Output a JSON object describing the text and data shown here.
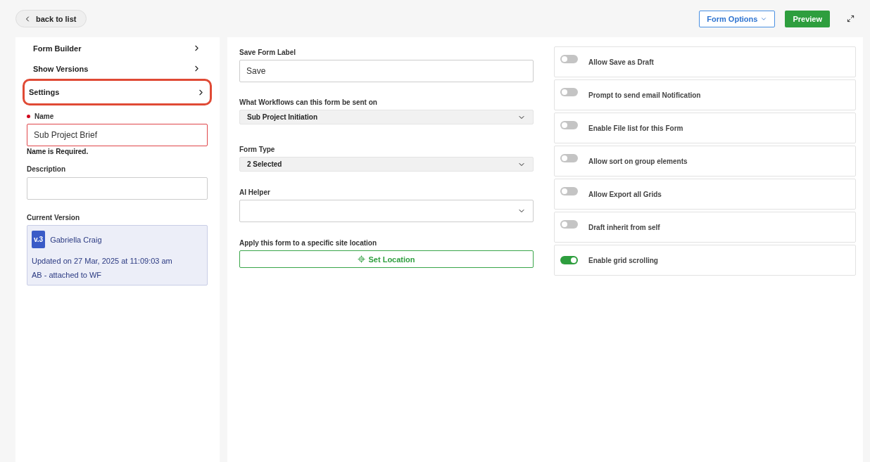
{
  "header": {
    "back_button": "back to list",
    "form_options": "Form Options",
    "preview": "Preview"
  },
  "nav": [
    {
      "label": "Form Builder",
      "highlighted": false
    },
    {
      "label": "Show Versions",
      "highlighted": false
    },
    {
      "label": "Settings",
      "highlighted": true
    }
  ],
  "name_field": {
    "label": "Name",
    "required": true,
    "value": "Sub Project Brief",
    "error": "Name is Required."
  },
  "description_field": {
    "label": "Description"
  },
  "current_version": {
    "label": "Current Version",
    "badge": "v.3",
    "author": "Gabriella Craig",
    "updated": "Updated on 27 Mar, 2025 at 11:09:03 am",
    "note": "AB - attached to WF"
  },
  "save_label_field": {
    "label": "Save Form Label",
    "value": "Save"
  },
  "workflows_select": {
    "label": "What Workflows can this form be sent on",
    "value": "Sub Project Initiation"
  },
  "form_type_select": {
    "label": "Form Type",
    "value": "2 Selected"
  },
  "ai_helper_select": {
    "label": "AI Helper"
  },
  "location": {
    "label": "Apply this form to a specific site location",
    "button": "Set Location"
  },
  "toggles": [
    {
      "label": "Allow Save as Draft",
      "on": false
    },
    {
      "label": "Prompt to send email Notification",
      "on": false
    },
    {
      "label": "Enable File list for this Form",
      "on": false
    },
    {
      "label": "Allow sort on group elements",
      "on": false
    },
    {
      "label": "Allow Export all Grids",
      "on": false
    },
    {
      "label": "Draft inherit from self",
      "on": false
    },
    {
      "label": "Enable grid scrolling",
      "on": true
    }
  ]
}
